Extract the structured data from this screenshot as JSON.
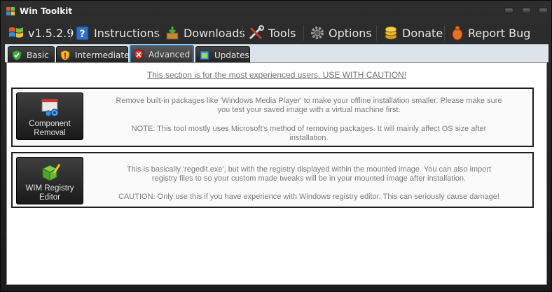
{
  "window": {
    "title": "Win Toolkit"
  },
  "menu": {
    "version": "v1.5.2.9",
    "items": [
      {
        "label": "Instructions",
        "icon": "help-book-icon"
      },
      {
        "label": "Downloads",
        "icon": "download-box-icon"
      },
      {
        "label": "Tools",
        "icon": "tools-icon"
      },
      {
        "label": "Options",
        "icon": "gear-icon"
      },
      {
        "label": "Donate",
        "icon": "coins-icon"
      },
      {
        "label": "Report Bug",
        "icon": "bug-icon"
      }
    ]
  },
  "tabs": [
    {
      "label": "Basic",
      "icon": "green-shield-icon"
    },
    {
      "label": "Intermediate",
      "icon": "yellow-shield-icon"
    },
    {
      "label": "Advanced",
      "icon": "red-shield-icon",
      "active": true
    },
    {
      "label": "Updates",
      "icon": "updates-icon"
    }
  ],
  "panel": {
    "caution": "This section is for the most experienced users.  USE WITH CAUTION!",
    "tools": [
      {
        "label_line1": "Component",
        "label_line2": "Removal",
        "icon": "component-removal-icon",
        "desc_line1": "Remove built-in packages like 'Windows Media Player' to make your offline installation smaller. Please make sure",
        "desc_line2": "you test your saved image with a virtual machine first.",
        "desc_line3": "NOTE: This tool mostly uses Microsoft's method of removing packages. It will mainly affect OS size after",
        "desc_line4": "installation."
      },
      {
        "label_line1": "WIM Registry",
        "label_line2": "Editor",
        "icon": "registry-editor-icon",
        "desc_line1": "This is basically 'regedit.exe', but with the registry displayed within the mounted image.  You can also import",
        "desc_line2": "registry files to so your custom made tweaks will be in your mounted image after installation.",
        "desc_line3": "CAUTION: Only use this if you have experience with Windows registry editor. This can seriously cause damage!"
      }
    ]
  },
  "colors": {
    "window_bg": "#262626",
    "tab_strip": "#dde3ea",
    "active_tab_border": "#2a88d8",
    "description_text": "#7a7a7a"
  }
}
